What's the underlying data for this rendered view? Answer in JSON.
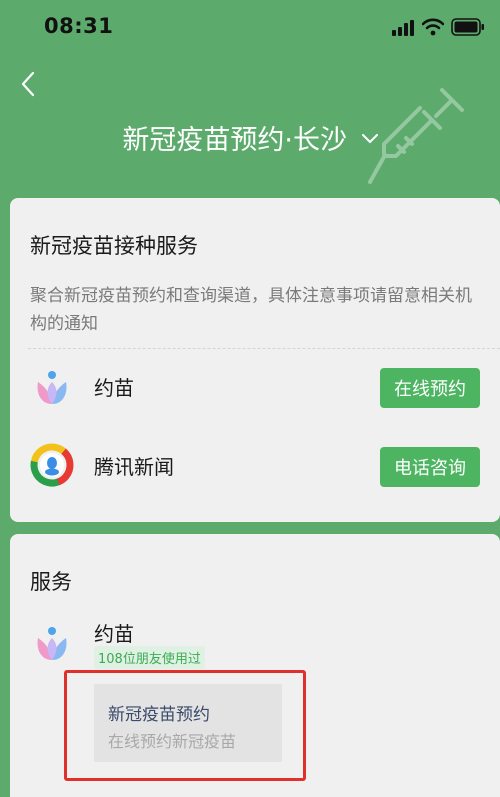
{
  "status_bar": {
    "time": "08:31"
  },
  "header": {
    "title": "新冠疫苗预约·长沙"
  },
  "service_card": {
    "title": "新冠疫苗接种服务",
    "description": "聚合新冠疫苗预约和查询渠道，具体注意事项请留意相关机构的通知",
    "rows": [
      {
        "name": "约苗",
        "button": "在线预约",
        "icon": "yuemiao-logo-icon"
      },
      {
        "name": "腾讯新闻",
        "button": "电话咨询",
        "icon": "tencent-news-logo-icon"
      }
    ]
  },
  "more_card": {
    "title": "服务",
    "service": {
      "name": "约苗",
      "badge": "108位朋友使用过",
      "item_title": "新冠疫苗预约",
      "item_subtitle": "在线预约新冠疫苗"
    }
  },
  "colors": {
    "header_background": "#5cab6d",
    "button_green": "#4db562",
    "highlight_red": "#e0302c"
  }
}
